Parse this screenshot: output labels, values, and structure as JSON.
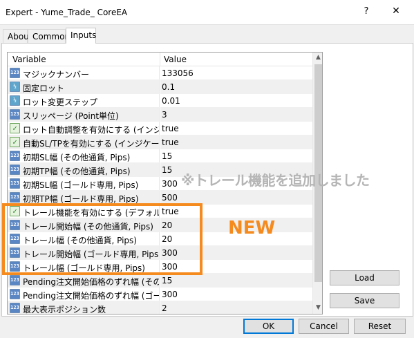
{
  "window": {
    "title": "Expert - Yume_Trade_ CoreEA",
    "help_glyph": "?",
    "close_glyph": "✕"
  },
  "tabs": [
    {
      "label": "About",
      "active": false
    },
    {
      "label": "Common",
      "active": false
    },
    {
      "label": "Inputs",
      "active": true
    }
  ],
  "grid": {
    "columns": [
      "Variable",
      "Value"
    ],
    "rows": [
      {
        "icon": "integer-icon",
        "name": "マジックナンバー",
        "value": "133056"
      },
      {
        "icon": "double-icon",
        "name": "固定ロット",
        "value": "0.1"
      },
      {
        "icon": "double-icon",
        "name": "ロット変更ステップ",
        "value": "0.01"
      },
      {
        "icon": "integer-icon",
        "name": "スリッページ (Point単位)",
        "value": "3"
      },
      {
        "icon": "bool-icon",
        "name": "ロット自動調整を有効にする (インジケ◆...",
        "value": "true"
      },
      {
        "icon": "bool-icon",
        "name": "自動SL/TPを有効にする (インジケータ...",
        "value": "true"
      },
      {
        "icon": "integer-icon",
        "name": "初期SL幅 (その他通貨, Pips)",
        "value": "15"
      },
      {
        "icon": "integer-icon",
        "name": "初期TP幅 (その他通貨, Pips)",
        "value": "15"
      },
      {
        "icon": "integer-icon",
        "name": "初期SL幅 (ゴールド専用, Pips)",
        "value": "300"
      },
      {
        "icon": "integer-icon",
        "name": "初期TP幅 (ゴールド専用, Pips)",
        "value": "500"
      },
      {
        "icon": "bool-icon",
        "name": "トレール機能を有効にする (デフォルトON)",
        "value": "true"
      },
      {
        "icon": "integer-icon",
        "name": "トレール開始幅 (その他通貨, Pips)",
        "value": "20"
      },
      {
        "icon": "integer-icon",
        "name": "トレール幅 (その他通貨, Pips)",
        "value": "20"
      },
      {
        "icon": "integer-icon",
        "name": "トレール開始幅 (ゴールド専用, Pips)",
        "value": "300"
      },
      {
        "icon": "integer-icon",
        "name": "トレール幅 (ゴールド専用, Pips)",
        "value": "300"
      },
      {
        "icon": "integer-icon",
        "name": "Pending注文開始価格のずれ幅 (その...",
        "value": "15"
      },
      {
        "icon": "integer-icon",
        "name": "Pending注文開始価格のずれ幅 (ゴー...",
        "value": "300"
      },
      {
        "icon": "integer-icon",
        "name": "最大表示ポジション数",
        "value": "2"
      }
    ]
  },
  "icon_labels": {
    "integer-icon": "123",
    "double-icon": "½",
    "bool-icon": "✓"
  },
  "buttons": {
    "load": "Load",
    "save": "Save",
    "ok": "OK",
    "cancel": "Cancel",
    "reset": "Reset"
  },
  "annotation": {
    "note": "※トレール機能を追加しました",
    "new": "NEW",
    "color": "#f58a1f"
  }
}
